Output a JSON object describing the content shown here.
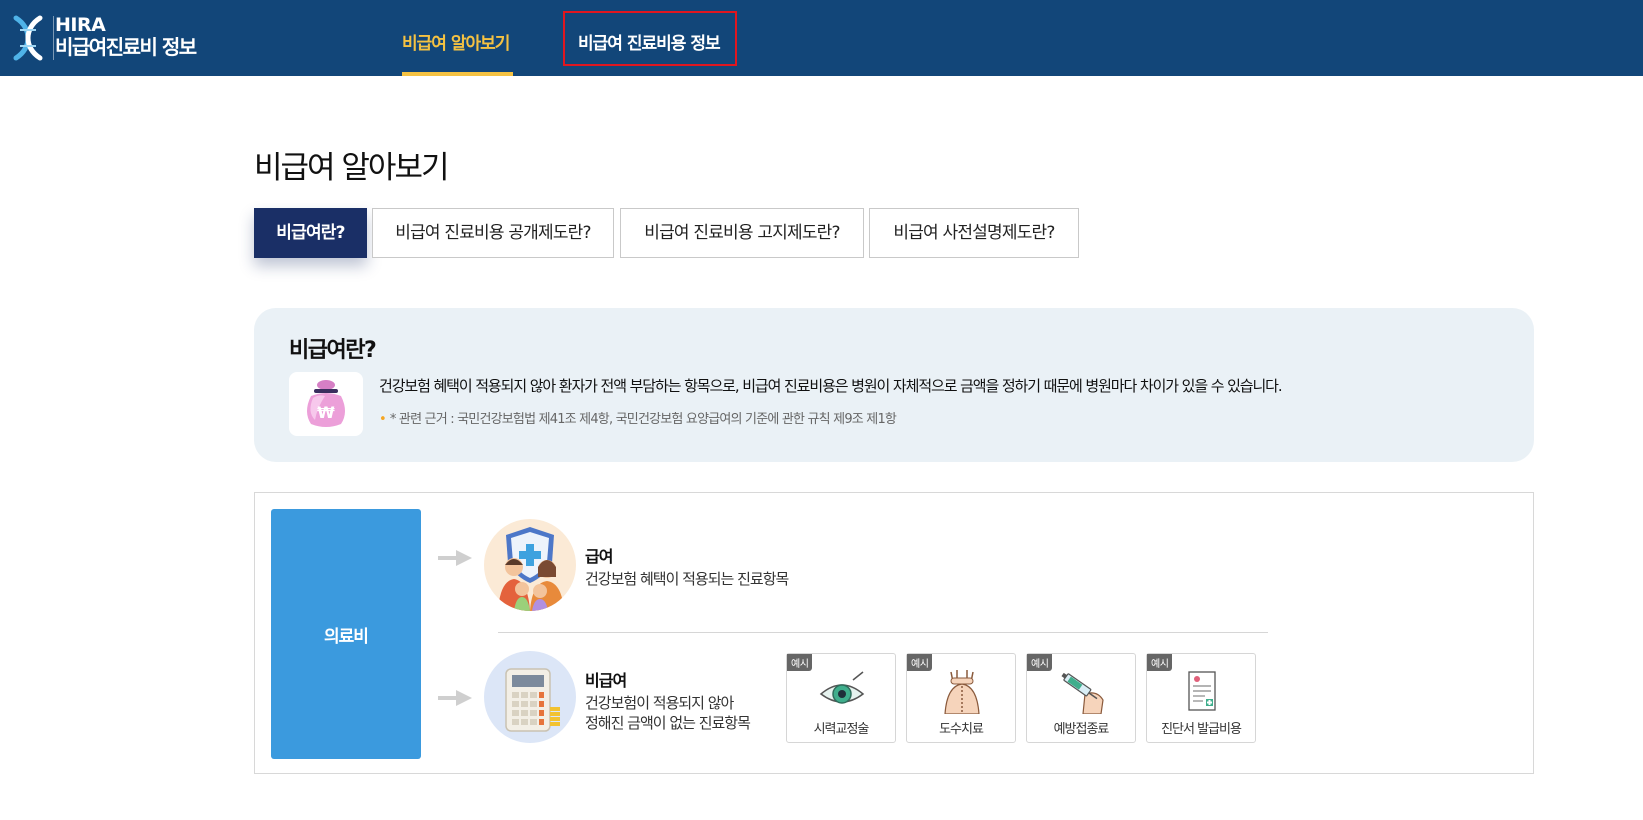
{
  "header": {
    "logo_line1": "HIRA",
    "logo_line2": "비급여진료비 정보",
    "nav": [
      {
        "label": "비급여 알아보기",
        "active": true
      },
      {
        "label": "비급여 진료비용 정보",
        "active": false
      }
    ]
  },
  "page_title": "비급여 알아보기",
  "tabs": [
    {
      "label": "비급여란?",
      "active": true
    },
    {
      "label": "비급여 진료비용 공개제도란?",
      "active": false
    },
    {
      "label": "비급여 진료비용 고지제도란?",
      "active": false
    },
    {
      "label": "비급여 사전설명제도란?",
      "active": false
    }
  ],
  "info": {
    "title": "비급여란?",
    "icon": "money-bag-icon",
    "description": "건강보험 혜택이 적용되지 않아 환자가 전액 부담하는 항목으로, 비급여 진료비용은 병원이 자체적으로 금액을 정하기 때문에 병원마다 차이가 있을 수 있습니다.",
    "note": "* 관련 근거 : 국민건강보험법 제41조 제4항, 국민건강보험 요양급여의 기준에 관한 규칙 제9조 제1항"
  },
  "diagram": {
    "root_label": "의료비",
    "covered": {
      "title": "급여",
      "desc": "건강보험 혜택이 적용되는 진료항목",
      "icon": "family-shield-icon"
    },
    "noncovered": {
      "title": "비급여",
      "desc_line1": "건강보험이 적용되지 않아",
      "desc_line2": "정해진 금액이 없는 진료항목",
      "icon": "calculator-icon"
    },
    "example_badge": "예시",
    "examples": [
      {
        "label": "시력교정술",
        "icon": "eye-icon"
      },
      {
        "label": "도수치료",
        "icon": "spine-therapy-icon"
      },
      {
        "label": "예방접종료",
        "icon": "syringe-icon"
      },
      {
        "label": "진단서 발급비용",
        "icon": "certificate-icon"
      }
    ]
  },
  "colors": {
    "header_bg": "#124679",
    "nav_active": "#f5c242",
    "highlight_border": "#e0161f",
    "tab_active_bg": "#1a2f66",
    "info_bg": "#eaf1f6",
    "root_box": "#3b9ade"
  }
}
